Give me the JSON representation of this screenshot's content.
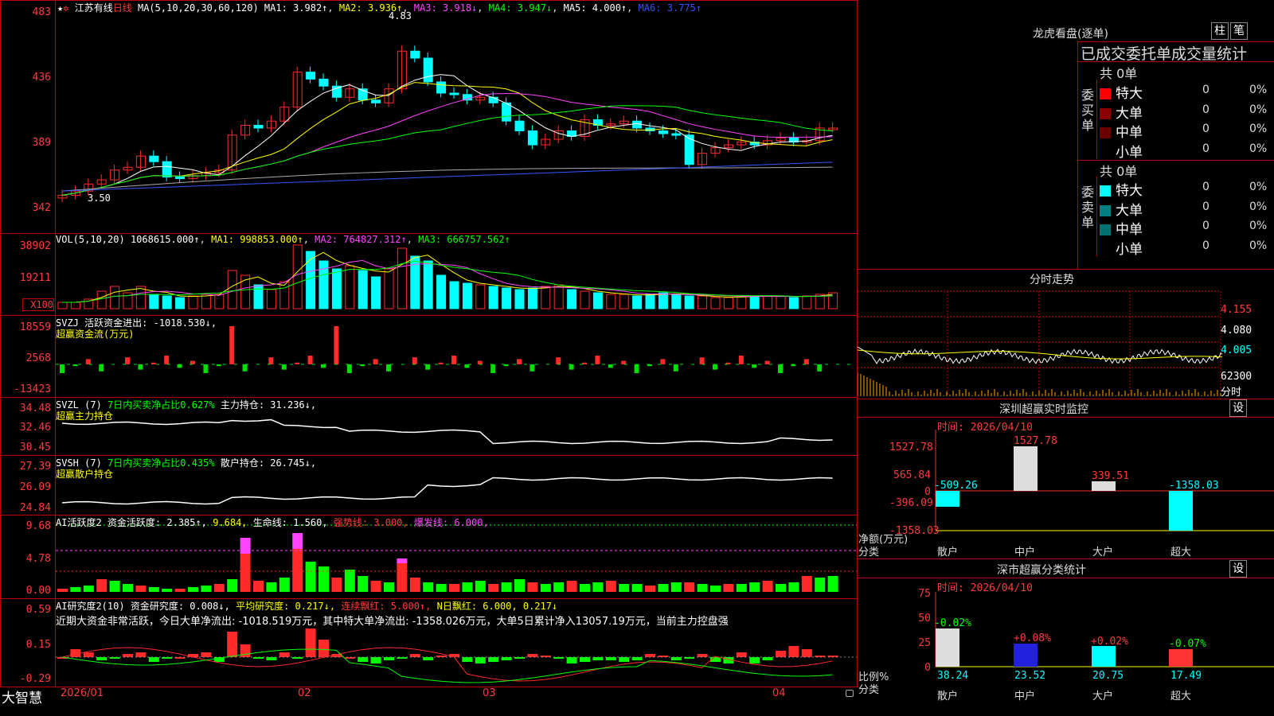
{
  "stock": {
    "name": "江苏有线",
    "period": "日线",
    "star": "★",
    "dot": "✲"
  },
  "ma": {
    "params": "MA(5,10,20,30,60,120)",
    "ma1": "MA1: 3.982↑",
    "ma2": "MA2: 3.936↑",
    "ma3": "MA3: 3.918↓",
    "ma4": "MA4: 3.947↓",
    "ma5": "MA5: 4.000↑",
    "ma6": "MA6: 3.775↑"
  },
  "price_axis": [
    "483",
    "436",
    "389",
    "342"
  ],
  "price_annot": {
    "high": "4.83",
    "low": "3.50"
  },
  "vol": {
    "label": "VOL(5,10,20)",
    "value": "1068615.000↑",
    "ma1": "MA1: 998853.000↑",
    "ma2": "MA2: 764827.312↑",
    "ma3": "MA3: 666757.562↑",
    "axis": [
      "38902",
      "19211"
    ],
    "unit": "X100"
  },
  "svzj": {
    "label": "SVZJ",
    "text": "活跃资金进出: -1018.530↓,",
    "sub": "超赢资金流(万元)",
    "axis": [
      "18559",
      "2568",
      "-13423"
    ]
  },
  "svzl": {
    "label": "SVZL (7)",
    "text1": "7日内买卖净占比0.627%",
    "text2": "主力持仓: 31.236↓,",
    "sub": "超赢主力持仓",
    "axis": [
      "34.48",
      "32.46",
      "30.45"
    ]
  },
  "svsh": {
    "label": "SVSH (7)",
    "text1": "7日内买卖净占比0.435%",
    "text2": "散户持仓: 26.745↓,",
    "sub": "超赢散户持仓",
    "axis": [
      "27.39",
      "26.09",
      "24.84"
    ]
  },
  "ai1": {
    "label": "AI活跃度2",
    "t1": "资金活跃度: 2.385↑,",
    "t2": "9.684,",
    "t3": "生命线: 1.560,",
    "t4": "强势线: 3.000,",
    "t5": "爆发线: 6.000,",
    "axis": [
      "9.68",
      "4.78",
      "0.00"
    ]
  },
  "ai2": {
    "label": "AI研究度2(10)",
    "t1": "资金研究度: 0.008↓,",
    "t2": "平均研究度: 0.217↓,",
    "t3": "连续飘红: 5.000↑,",
    "t4": "N日飘红: 6.000, 0.217↓",
    "desc": "近期大资金非常活跃，今日大单净流出: -1018.519万元，其中特大单净流出: -1358.026万元，大单5日累计净入13057.19万元，当前主力控盘强",
    "axis": [
      "0.59",
      "0.15",
      "-0.29"
    ]
  },
  "date_axis": [
    "2026/01",
    "02",
    "03",
    "04"
  ],
  "bottom_logo": "大智慧",
  "right": {
    "lhb_title": "龙虎看盘(逐单)",
    "btn_zhu": "柱",
    "btn_bi": "笔",
    "stats_title": "已成交委托单成交量统计",
    "buy_total": "共 0单",
    "buy_side": "委买单",
    "sell_total": "共 0单",
    "sell_side": "委卖单",
    "rows": [
      "特大",
      "大单",
      "中单",
      "小单"
    ],
    "zero": "0",
    "pct": "0%",
    "fenshi_title": "分时走势",
    "fenshi_axis": [
      "4.155",
      "4.080",
      "4.005",
      "62300",
      "分时"
    ],
    "sz_title": "深圳超赢实时监控",
    "sz_time": "时间: 2026/04/10",
    "sz_btn": "设",
    "sz_axis": [
      "1527.78",
      "565.84",
      "0",
      "-396.09",
      "-1358.03"
    ],
    "sz_vals": [
      "-509.26",
      "1527.78",
      "339.51",
      "-1358.03"
    ],
    "sz_ylabel": "净额(万元)",
    "sz_xlabel": "分类",
    "cats": [
      "散户",
      "中户",
      "大户",
      "超大"
    ],
    "cls_title": "深市超赢分类统计",
    "cls_time": "时间: 2026/04/10",
    "cls_btn": "设",
    "cls_axis": [
      "75",
      "50",
      "25",
      "0"
    ],
    "cls_changes": [
      "-0.02%",
      "+0.08%",
      "+0.02%",
      "-0.07%"
    ],
    "cls_vals": [
      "38.24",
      "23.52",
      "20.75",
      "17.49"
    ],
    "cls_ylabel": "比例%",
    "cls_xlabel": "分类"
  },
  "colors": {
    "up": "#ff2a2a",
    "down": "#00ffff",
    "frame": "#c00000"
  }
}
